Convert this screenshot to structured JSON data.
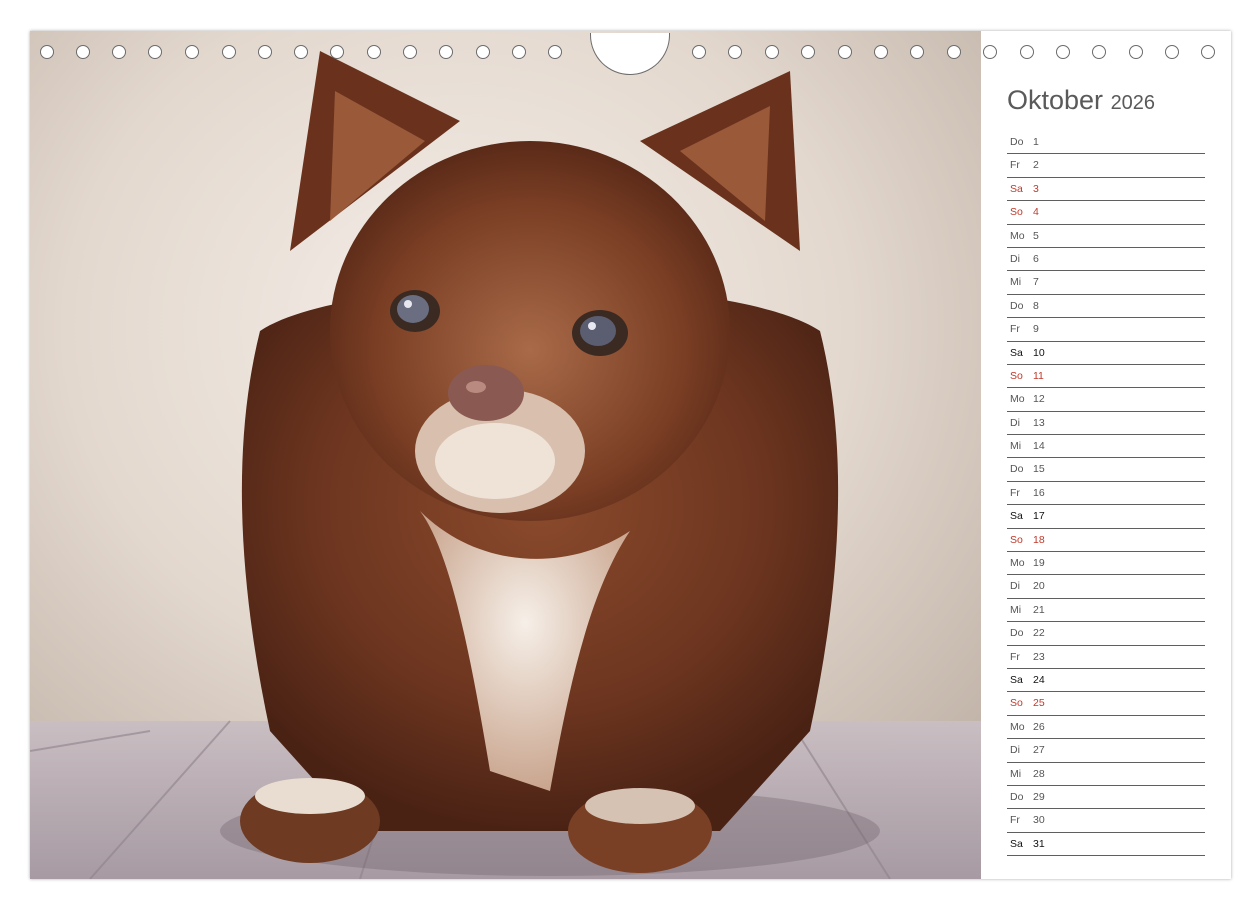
{
  "calendar": {
    "month": "Oktober",
    "year": "2026",
    "days": [
      {
        "wd": "Do",
        "d": "1",
        "style": "normal"
      },
      {
        "wd": "Fr",
        "d": "2",
        "style": "normal"
      },
      {
        "wd": "Sa",
        "d": "3",
        "style": "holiday"
      },
      {
        "wd": "So",
        "d": "4",
        "style": "holiday"
      },
      {
        "wd": "Mo",
        "d": "5",
        "style": "normal"
      },
      {
        "wd": "Di",
        "d": "6",
        "style": "normal"
      },
      {
        "wd": "Mi",
        "d": "7",
        "style": "normal"
      },
      {
        "wd": "Do",
        "d": "8",
        "style": "normal"
      },
      {
        "wd": "Fr",
        "d": "9",
        "style": "normal"
      },
      {
        "wd": "Sa",
        "d": "10",
        "style": "saturday"
      },
      {
        "wd": "So",
        "d": "11",
        "style": "holiday"
      },
      {
        "wd": "Mo",
        "d": "12",
        "style": "normal"
      },
      {
        "wd": "Di",
        "d": "13",
        "style": "normal"
      },
      {
        "wd": "Mi",
        "d": "14",
        "style": "normal"
      },
      {
        "wd": "Do",
        "d": "15",
        "style": "normal"
      },
      {
        "wd": "Fr",
        "d": "16",
        "style": "normal"
      },
      {
        "wd": "Sa",
        "d": "17",
        "style": "saturday"
      },
      {
        "wd": "So",
        "d": "18",
        "style": "holiday"
      },
      {
        "wd": "Mo",
        "d": "19",
        "style": "normal"
      },
      {
        "wd": "Di",
        "d": "20",
        "style": "normal"
      },
      {
        "wd": "Mi",
        "d": "21",
        "style": "normal"
      },
      {
        "wd": "Do",
        "d": "22",
        "style": "normal"
      },
      {
        "wd": "Fr",
        "d": "23",
        "style": "normal"
      },
      {
        "wd": "Sa",
        "d": "24",
        "style": "saturday"
      },
      {
        "wd": "So",
        "d": "25",
        "style": "holiday"
      },
      {
        "wd": "Mo",
        "d": "26",
        "style": "normal"
      },
      {
        "wd": "Di",
        "d": "27",
        "style": "normal"
      },
      {
        "wd": "Mi",
        "d": "28",
        "style": "normal"
      },
      {
        "wd": "Do",
        "d": "29",
        "style": "normal"
      },
      {
        "wd": "Fr",
        "d": "30",
        "style": "normal"
      },
      {
        "wd": "Sa",
        "d": "31",
        "style": "saturday"
      }
    ]
  },
  "colors": {
    "holiday": "#c0392b",
    "saturday": "#111111",
    "normal": "#555555"
  },
  "photo": {
    "subject": "long-haired brown chihuahua lying on wooden floor"
  }
}
